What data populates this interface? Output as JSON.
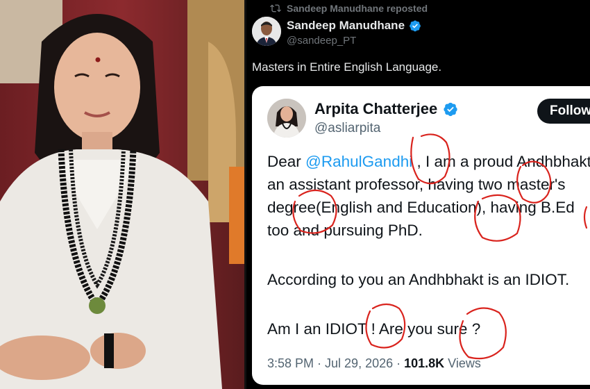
{
  "photo": {
    "description_icon": "portrait-photo"
  },
  "repost": {
    "icon": "repost-icon",
    "label": "Sandeep Manudhane reposted"
  },
  "outer_post": {
    "display_name": "Sandeep Manudhane",
    "handle": "@sandeep_PT",
    "text": "Masters in Entire English Language."
  },
  "quoted_post": {
    "display_name": "Arpita Chatterjee",
    "handle": "@asliarpita",
    "follow_label": "Follow",
    "line1_prefix": "Dear ",
    "line1_mention": "@RahulGandhi",
    "line1_suffix": " , I am a proud Andhbhakt,",
    "line2": "an assistant professor, having two master's",
    "line3": "degree(English and Education), having B.Ed",
    "line4": "too and pursuing PhD.",
    "line5": "According to you an Andhbhakt is an IDIOT.",
    "line6": "Am I an IDIOT ! Are you sure ?",
    "time": "3:58 PM · Jul 29, 2026 · ",
    "views_count": "101.8K",
    "views_label": " Views"
  },
  "colors": {
    "accent": "#1d9bf0",
    "annotation": "#d9231d",
    "background": "#000000",
    "card": "#ffffff"
  }
}
